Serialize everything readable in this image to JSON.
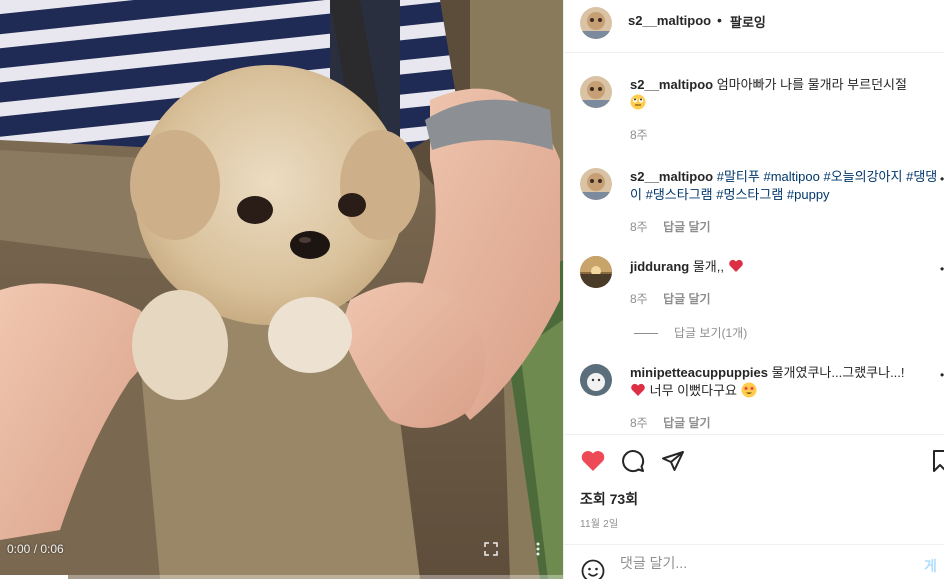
{
  "video": {
    "time": "0:00 / 0:06",
    "progress": 0.12,
    "fullscreen_icon": "fullscreen-icon",
    "more_icon": "more-vertical-icon"
  },
  "post": {
    "author": "s2__maltipoo",
    "separator": "•",
    "follow_label": "팔로잉"
  },
  "comments": [
    {
      "username": "s2__maltipoo",
      "text": "엄마아빠가 나를 물개라 부르던시절",
      "emoji": "rolling-eyes-emoji",
      "time": "8주",
      "reply_label": ""
    },
    {
      "username": "s2__maltipoo",
      "text_parts": [
        "#말티푸",
        "#maltipoo",
        "#오늘의강아지",
        "#댕댕이",
        "#댕스타그램",
        "#멍스타그램",
        "#puppy"
      ],
      "time": "8주",
      "reply_label": "답글 달기"
    },
    {
      "username": "jiddurang",
      "text": "물개,,",
      "emoji": "red-heart-emoji",
      "time": "8주",
      "reply_label": "답글 달기",
      "view_replies": "답글 보기(1개)"
    },
    {
      "username": "minipetteacuppuppies",
      "text": "물개였쿠나...그랬쿠나...!",
      "text2": "너무 이뻤다구요",
      "time": "8주",
      "reply_label": "답글 달기"
    }
  ],
  "actions": {
    "like_icon": "heart-filled-icon",
    "comment_icon": "comment-icon",
    "share_icon": "paper-plane-icon",
    "save_icon": "bookmark-icon",
    "like_color": "#ed4956"
  },
  "stats": {
    "views": "조회 73회",
    "date": "11월 2일"
  },
  "add_comment": {
    "placeholder": "댓글 달기...",
    "post_label": "게시"
  }
}
